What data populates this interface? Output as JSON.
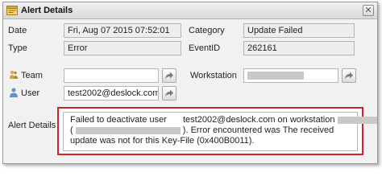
{
  "window": {
    "title": "Alert Details",
    "close_glyph": "✕"
  },
  "fields": {
    "date": {
      "label": "Date",
      "value": "Fri, Aug 07 2015 07:52:01"
    },
    "category": {
      "label": "Category",
      "value": "Update Failed"
    },
    "type": {
      "label": "Type",
      "value": "Error"
    },
    "event_id": {
      "label": "EventID",
      "value": "262161"
    },
    "team": {
      "label": "Team",
      "value": ""
    },
    "workstation": {
      "label": "Workstation",
      "value": ""
    },
    "user": {
      "label": "User",
      "value": "test2002@deslock.com"
    }
  },
  "alert_details": {
    "label": "Alert Details",
    "line1_part1": "Failed to deactivate user",
    "line1_part2": "test2002@deslock.com on workstation",
    "line1_end": "(",
    "line2_start": "(",
    "line2_part2": "). Error encountered was The received",
    "line3": "update was not for this Key-File (0x400B0011)."
  },
  "icons": {
    "title": "alert-window-icon",
    "team": "team-icon",
    "user": "user-icon",
    "picker": "forward-arrow-icon"
  },
  "colors": {
    "highlight_border": "#d61f26"
  }
}
